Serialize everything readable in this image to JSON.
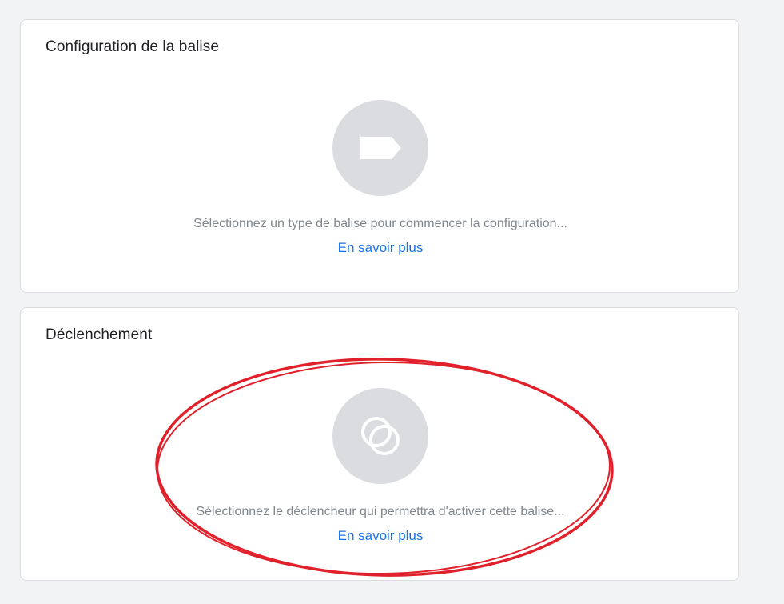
{
  "tag_configuration": {
    "title": "Configuration de la balise",
    "icon": "tag-icon",
    "hint": "Sélectionnez un type de balise pour commencer la configuration...",
    "learn_more": "En savoir plus"
  },
  "triggering": {
    "title": "Déclenchement",
    "icon": "trigger-icon",
    "hint": "Sélectionnez le déclencheur qui permettra d'activer cette balise...",
    "learn_more": "En savoir plus"
  },
  "colors": {
    "background": "#f1f3f4",
    "card": "#ffffff",
    "icon_circle": "#dadce0",
    "link": "#1a73e8",
    "hint_text": "#80868b",
    "annotation": "#e0202a"
  }
}
